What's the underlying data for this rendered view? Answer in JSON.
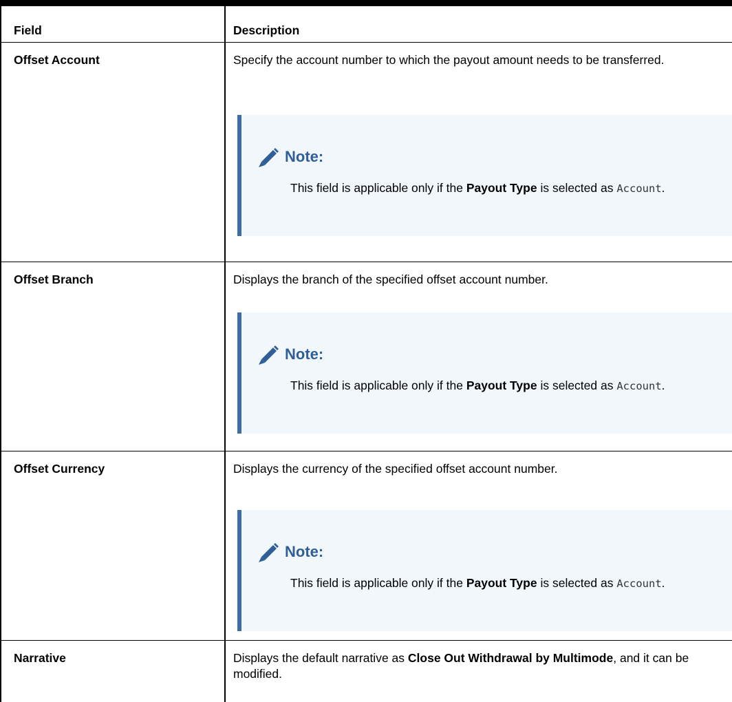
{
  "table": {
    "headers": {
      "field": "Field",
      "description": "Description"
    },
    "rows": [
      {
        "field": "Offset Account",
        "description": "Specify the account number to which the payout amount needs to be transferred.",
        "note": {
          "title": "Note:",
          "text_before": "This field is applicable only if the ",
          "bold": "Payout Type",
          "text_middle": " is selected as ",
          "code": "Account",
          "text_after": "."
        }
      },
      {
        "field": "Offset Branch",
        "description": "Displays the branch of the specified offset account number.",
        "note": {
          "title": "Note:",
          "text_before": "This field is applicable only if the ",
          "bold": "Payout Type",
          "text_middle": " is selected as ",
          "code": "Account",
          "text_after": "."
        }
      },
      {
        "field": "Offset Currency",
        "description": "Displays the currency of the specified offset account number.",
        "note": {
          "title": "Note:",
          "text_before": "This field is applicable only if the ",
          "bold": "Payout Type",
          "text_middle": " is selected as ",
          "code": "Account",
          "text_after": "."
        }
      },
      {
        "field": "Narrative",
        "description_before": "Displays the default narrative as ",
        "description_bold": "Close Out Withdrawal by Multimode",
        "description_after": ", and it can be modified."
      }
    ]
  },
  "icons": {
    "note": "pencil-icon"
  },
  "colors": {
    "note_background": "#f2f7fc",
    "note_border": "#3a6ea5",
    "note_title": "#2f5f96"
  }
}
